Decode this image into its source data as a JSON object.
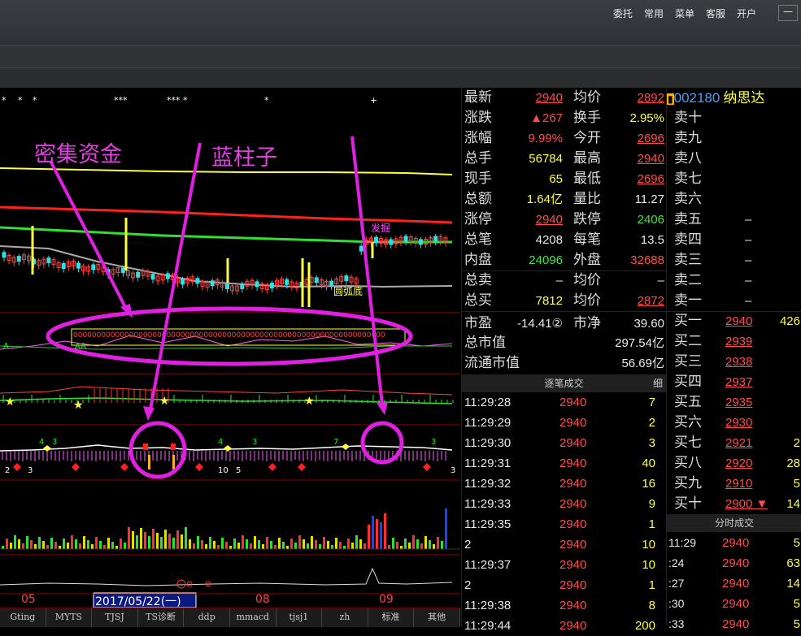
{
  "top_menu": [
    "委托",
    "常用",
    "菜单",
    "客服",
    "开户"
  ],
  "minimize": "一",
  "annotations": {
    "a1": "密集资金",
    "a2": "蓝柱子"
  },
  "chart_labels": {
    "fa_jue": "发掘",
    "yuan_hu_di": "圆弧底",
    "aa1": "A",
    "aa2": "AA",
    "date_box": "2017/05/22(一)",
    "m05": "05",
    "m08": "08",
    "m09": "09"
  },
  "bottom_tabs": [
    "Gting",
    "MYTS",
    "TJSJ",
    "TS诊断",
    "ddp",
    "mmacd",
    "tjsj1",
    "zh",
    "标准",
    "其他"
  ],
  "quote": [
    {
      "l": "最新",
      "v": "2940",
      "vc": "red ul",
      "l2": "均价",
      "v2": "2892",
      "v2c": "red ul"
    },
    {
      "l": "涨跌",
      "v": "▲267",
      "vc": "red",
      "l2": "换手",
      "v2": "2.95%",
      "v2c": "yellow"
    },
    {
      "l": "涨幅",
      "v": "9.99%",
      "vc": "red",
      "l2": "今开",
      "v2": "2696",
      "v2c": "red ul"
    },
    {
      "l": "总手",
      "v": "56784",
      "vc": "yellow",
      "l2": "最高",
      "v2": "2940",
      "v2c": "red ul"
    },
    {
      "l": "现手",
      "v": "65",
      "vc": "yellow",
      "l2": "最低",
      "v2": "2696",
      "v2c": "red ul"
    },
    {
      "l": "总额",
      "v": "1.64亿",
      "vc": "yellow",
      "l2": "量比",
      "v2": "11.27",
      "v2c": "white"
    },
    {
      "l": "涨停",
      "v": "2940",
      "vc": "red ul",
      "l2": "跌停",
      "v2": "2406",
      "v2c": "green"
    },
    {
      "l": "总笔",
      "v": "4208",
      "vc": "white",
      "l2": "每笔",
      "v2": "13.5",
      "v2c": "white"
    },
    {
      "l": "内盘",
      "v": "24096",
      "vc": "green",
      "l2": "外盘",
      "v2": "32688",
      "v2c": "red"
    },
    {
      "l": "总卖",
      "v": "–",
      "vc": "white",
      "l2": "均价",
      "v2": "–",
      "v2c": "white"
    },
    {
      "l": "总买",
      "v": "7812",
      "vc": "yellow",
      "l2": "均价",
      "v2": "2872",
      "v2c": "red ul"
    },
    {
      "l": "市盈",
      "v": "-14.41②",
      "vc": "white",
      "l2": "市净",
      "v2": "39.60",
      "v2c": "white"
    }
  ],
  "total_mv": {
    "label": "总市值",
    "value": "297.54亿"
  },
  "float_mv": {
    "label": "流通市值",
    "value": "56.69亿"
  },
  "trade_header": "逐笔成交",
  "trade_detail": "细",
  "trades": [
    {
      "t": "11:29:28",
      "p": "2940",
      "q": "7"
    },
    {
      "t": "11:29:29",
      "p": "2940",
      "q": "2"
    },
    {
      "t": "11:29:30",
      "p": "2940",
      "q": "3"
    },
    {
      "t": "11:29:31",
      "p": "2940",
      "q": "40"
    },
    {
      "t": "11:29:32",
      "p": "2940",
      "q": "16"
    },
    {
      "t": "11:29:33",
      "p": "2940",
      "q": "9"
    },
    {
      "t": "11:29:35",
      "p": "2940",
      "q": "1"
    },
    {
      "t": "2",
      "p": "2940",
      "q": "10"
    },
    {
      "t": "11:29:37",
      "p": "2940",
      "q": "10"
    },
    {
      "t": "2",
      "p": "2940",
      "q": "1"
    },
    {
      "t": "11:29:38",
      "p": "2940",
      "q": "8"
    },
    {
      "t": "11:29:44",
      "p": "2940",
      "q": "200"
    }
  ],
  "stock": {
    "code": "002180",
    "name": "纳思达"
  },
  "sells": [
    {
      "l": "卖十",
      "p": "",
      "q": ""
    },
    {
      "l": "卖九",
      "p": "",
      "q": ""
    },
    {
      "l": "卖八",
      "p": "",
      "q": ""
    },
    {
      "l": "卖七",
      "p": "",
      "q": ""
    },
    {
      "l": "卖六",
      "p": "",
      "q": ""
    },
    {
      "l": "卖五",
      "p": "–",
      "q": ""
    },
    {
      "l": "卖四",
      "p": "–",
      "q": ""
    },
    {
      "l": "卖三",
      "p": "–",
      "q": ""
    },
    {
      "l": "卖二",
      "p": "–",
      "q": ""
    },
    {
      "l": "卖一",
      "p": "–",
      "q": ""
    }
  ],
  "buys": [
    {
      "l": "买一",
      "p": "2940",
      "q": "426"
    },
    {
      "l": "买二",
      "p": "2939",
      "q": ""
    },
    {
      "l": "买三",
      "p": "2938",
      "q": ""
    },
    {
      "l": "买四",
      "p": "2937",
      "q": ""
    },
    {
      "l": "买五",
      "p": "2935",
      "q": ""
    },
    {
      "l": "买六",
      "p": "2930",
      "q": ""
    },
    {
      "l": "买七",
      "p": "2921",
      "q": "2"
    },
    {
      "l": "买八",
      "p": "2920",
      "q": "28"
    },
    {
      "l": "买九",
      "p": "2910",
      "q": "5"
    },
    {
      "l": "买十",
      "p": "2900 ▼",
      "q": "14"
    }
  ],
  "tick_header": "分时成交",
  "ticks": [
    {
      "t": "11:29",
      "p": "2940",
      "q": "5"
    },
    {
      "t": ":24",
      "p": "2940",
      "q": "63"
    },
    {
      "t": ":27",
      "p": "2940",
      "q": "14"
    },
    {
      "t": ":30",
      "p": "2940",
      "q": "5"
    },
    {
      "t": ":33",
      "p": "2940",
      "q": "5"
    }
  ]
}
